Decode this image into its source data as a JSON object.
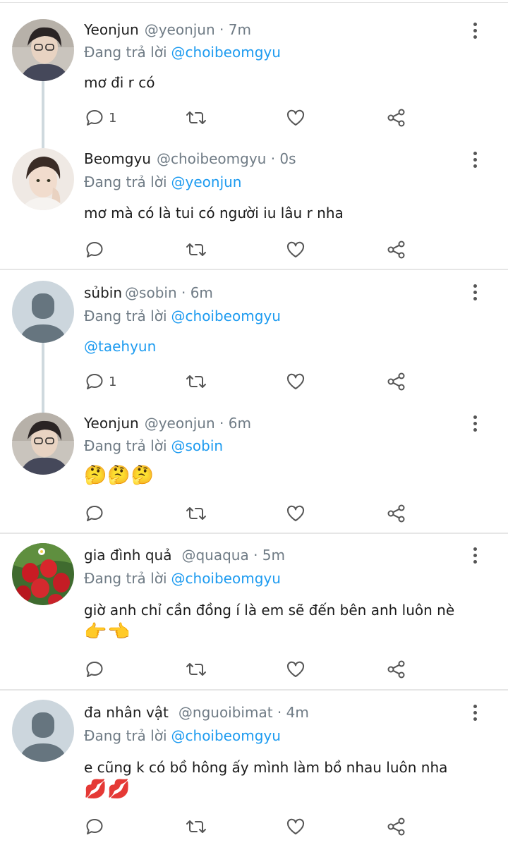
{
  "reply_prefix": "Đang trả lời",
  "tweets": [
    {
      "name": "Yeonjun",
      "handle": "@yeonjun · 7m",
      "reply_to": "@choibeomgyu",
      "text": "mơ đi r có",
      "emoji": "",
      "reply_count": "1",
      "avatar": "yeonjun-photo"
    },
    {
      "name": "Beomgyu",
      "handle": "@choibeomgyu · 0s",
      "reply_to": "@yeonjun",
      "text": "mơ mà có là tui có người iu lâu r nha",
      "emoji": "",
      "reply_count": "",
      "avatar": "beomgyu-photo"
    },
    {
      "name": "sủbin",
      "handle": "@sobin · 6m",
      "reply_to": "@choibeomgyu",
      "text": "@taehyun",
      "emoji": "",
      "reply_count": "1",
      "avatar": "default-avatar"
    },
    {
      "name": "Yeonjun",
      "handle": "@yeonjun · 6m",
      "reply_to": "@sobin",
      "text": "",
      "emoji": "🤔🤔🤔",
      "reply_count": "",
      "avatar": "yeonjun-photo"
    },
    {
      "name": "gia đình quả",
      "handle": "@quaqua · 5m",
      "reply_to": "@choibeomgyu",
      "text": "giờ anh chỉ cần đồng í là em sẽ đến bên anh luôn nè",
      "emoji": "👉👈",
      "reply_count": "",
      "avatar": "strawberry-photo"
    },
    {
      "name": "đa nhân vật",
      "handle": "@nguoibimat · 4m",
      "reply_to": "@choibeomgyu",
      "text": "e cũng k có bồ hông ấy mình làm bồ nhau luôn nha",
      "emoji": "💋💋",
      "reply_count": "",
      "avatar": "default-avatar"
    }
  ],
  "colors": {
    "link": "#1d9bf0",
    "muted": "#6f7b85",
    "thread_line": "#cfd9de"
  }
}
